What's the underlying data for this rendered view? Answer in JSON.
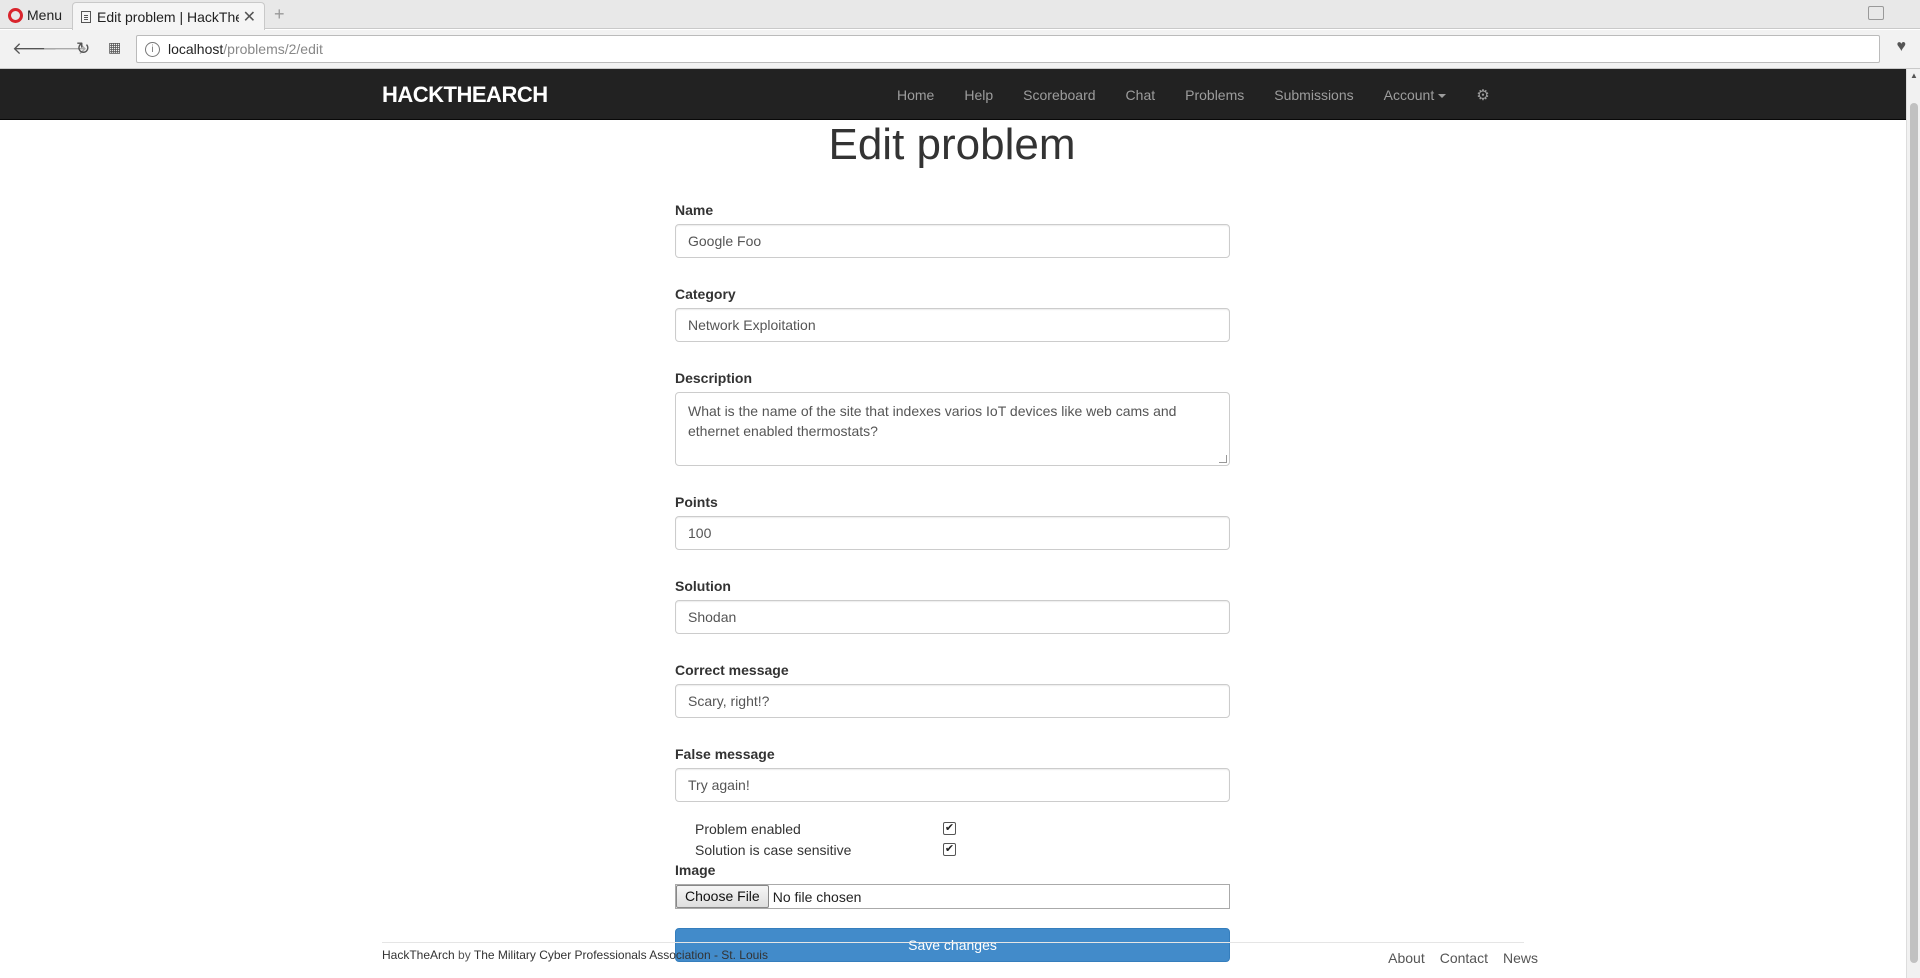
{
  "browser": {
    "menu_label": "Menu",
    "tab_title": "Edit problem | HackTheA",
    "url_host": "localhost",
    "url_path": "/problems/2/edit"
  },
  "navbar": {
    "brand": "HACKTHEARCH",
    "links": [
      "Home",
      "Help",
      "Scoreboard",
      "Chat",
      "Problems",
      "Submissions"
    ],
    "account_label": "Account"
  },
  "page": {
    "title": "Edit problem"
  },
  "form": {
    "name": {
      "label": "Name",
      "value": "Google Foo"
    },
    "category": {
      "label": "Category",
      "value": "Network Exploitation"
    },
    "description": {
      "label": "Description",
      "value": "What is the name of the site that indexes varios IoT devices like web cams and ethernet enabled thermostats?"
    },
    "points": {
      "label": "Points",
      "value": "100"
    },
    "solution": {
      "label": "Solution",
      "value": "Shodan"
    },
    "correct_message": {
      "label": "Correct message",
      "value": "Scary, right!?"
    },
    "false_message": {
      "label": "False message",
      "value": "Try again!"
    },
    "problem_enabled": {
      "label": "Problem enabled",
      "checked": true
    },
    "case_sensitive": {
      "label": "Solution is case sensitive",
      "checked": true
    },
    "image": {
      "label": "Image",
      "button": "Choose File",
      "status": "No file chosen"
    },
    "submit_label": "Save changes"
  },
  "footer": {
    "site": "HackTheArch",
    "by": "by",
    "org": "The Military Cyber Professionals Association - St. Louis",
    "links": [
      "About",
      "Contact",
      "News"
    ]
  }
}
